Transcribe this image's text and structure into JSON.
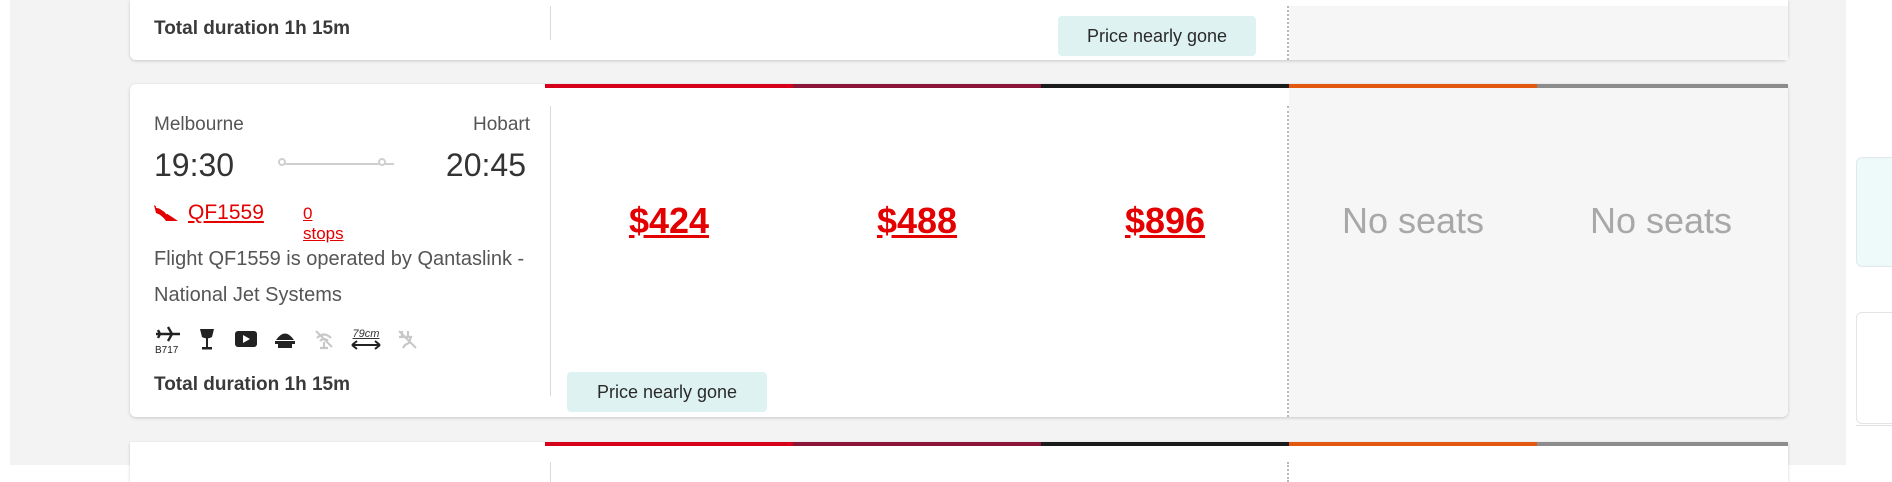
{
  "colors": {
    "fare_economy_sale": "#d7001b",
    "fare_economy_flex": "#8a1538",
    "fare_business": "#1b1b1b",
    "fare_premium": "#e3570e",
    "fare_other": "#8c8c8c",
    "price_red": "#e40000",
    "badge_bg": "#def3f1"
  },
  "previous_flight": {
    "total_duration": "Total duration 1h 15m",
    "badge": "Price nearly gone"
  },
  "flight": {
    "origin": "Melbourne",
    "destination": "Hobart",
    "depart_time": "19:30",
    "arrive_time": "20:45",
    "flight_number": "QF1559",
    "stops": "0 stops",
    "operated_by": "Flight QF1559 is operated by Qantaslink - National Jet Systems",
    "amenities": [
      {
        "icon": "aircraft-icon",
        "label": "B717"
      },
      {
        "icon": "wine-glass-icon",
        "label": ""
      },
      {
        "icon": "entertainment-icon",
        "label": ""
      },
      {
        "icon": "meal-icon",
        "label": ""
      },
      {
        "icon": "no-wifi-icon",
        "label": ""
      },
      {
        "icon": "seat-pitch-icon",
        "label": "79cm"
      },
      {
        "icon": "no-power-icon",
        "label": ""
      }
    ],
    "total_duration": "Total duration 1h 15m",
    "fares": [
      {
        "price": "$424",
        "badge": "Price nearly gone"
      },
      {
        "price": "$488"
      },
      {
        "price": "$896"
      },
      {
        "price": "No seats"
      },
      {
        "price": "No seats"
      }
    ]
  }
}
